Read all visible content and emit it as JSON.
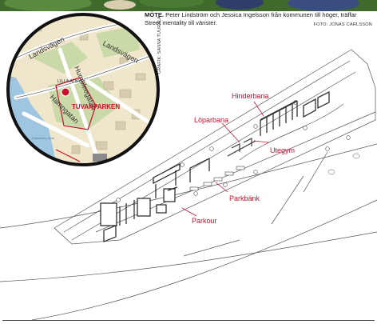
{
  "caption": {
    "lead": "MÖTE.",
    "text": " Peter Lindström och Jessica Ingelsson från kommunen till höger, träffar Street mentality till vänster."
  },
  "photo_credit": "FOTO: JONAS CARLSSON",
  "graphic_credit": "GRAFIK: SANNA TUURALA",
  "map": {
    "streets": [
      "Landsvägen",
      "Landsvägen",
      "Humbleegatan",
      "Hamngatan"
    ],
    "place": "LILLA ALBY",
    "park": "TUVANPARKEN",
    "small_label": "Edsvikens vikar"
  },
  "zones": {
    "hinderbana": "Hinderbana",
    "loparbana": "Löparbana",
    "utegym": "Utegym",
    "parkbank": "Parkbänk",
    "parkour": "Parkour"
  },
  "colors": {
    "label_red": "#c8102e",
    "map_road": "#f4ecd2",
    "map_green": "#c9d9a8",
    "water": "#9fc6e0"
  }
}
